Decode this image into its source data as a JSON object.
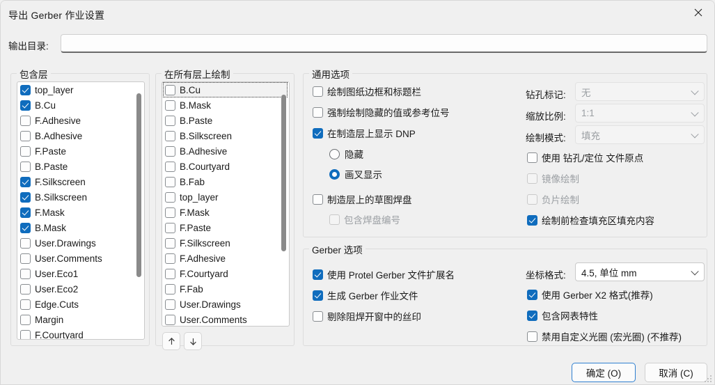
{
  "window": {
    "title": "导出 Gerber 作业设置",
    "close_icon": "close-icon"
  },
  "output_dir": {
    "label": "输出目录:",
    "value": "",
    "placeholder": ""
  },
  "include_layers": {
    "title": "包含层",
    "items": [
      {
        "label": "top_layer",
        "checked": true
      },
      {
        "label": "B.Cu",
        "checked": true
      },
      {
        "label": "F.Adhesive",
        "checked": false
      },
      {
        "label": "B.Adhesive",
        "checked": false
      },
      {
        "label": "F.Paste",
        "checked": false
      },
      {
        "label": "B.Paste",
        "checked": false
      },
      {
        "label": "F.Silkscreen",
        "checked": true
      },
      {
        "label": "B.Silkscreen",
        "checked": true
      },
      {
        "label": "F.Mask",
        "checked": true
      },
      {
        "label": "B.Mask",
        "checked": true
      },
      {
        "label": "User.Drawings",
        "checked": false
      },
      {
        "label": "User.Comments",
        "checked": false
      },
      {
        "label": "User.Eco1",
        "checked": false
      },
      {
        "label": "User.Eco2",
        "checked": false
      },
      {
        "label": "Edge.Cuts",
        "checked": false
      },
      {
        "label": "Margin",
        "checked": false
      },
      {
        "label": "F.Courtyard",
        "checked": false
      }
    ]
  },
  "plot_on_all_layers": {
    "title": "在所有层上绘制",
    "items": [
      {
        "label": "B.Cu",
        "checked": false,
        "focused": true
      },
      {
        "label": "B.Mask",
        "checked": false,
        "focused": false
      },
      {
        "label": "B.Paste",
        "checked": false,
        "focused": false
      },
      {
        "label": "B.Silkscreen",
        "checked": false,
        "focused": false
      },
      {
        "label": "B.Adhesive",
        "checked": false,
        "focused": false
      },
      {
        "label": "B.Courtyard",
        "checked": false,
        "focused": false
      },
      {
        "label": "B.Fab",
        "checked": false,
        "focused": false
      },
      {
        "label": "top_layer",
        "checked": false,
        "focused": false
      },
      {
        "label": "F.Mask",
        "checked": false,
        "focused": false
      },
      {
        "label": "F.Paste",
        "checked": false,
        "focused": false
      },
      {
        "label": "F.Silkscreen",
        "checked": false,
        "focused": false
      },
      {
        "label": "F.Adhesive",
        "checked": false,
        "focused": false
      },
      {
        "label": "F.Courtyard",
        "checked": false,
        "focused": false
      },
      {
        "label": "F.Fab",
        "checked": false,
        "focused": false
      },
      {
        "label": "User.Drawings",
        "checked": false,
        "focused": false
      },
      {
        "label": "User.Comments",
        "checked": false,
        "focused": false
      }
    ],
    "move_up_icon": "arrow-up-icon",
    "move_down_icon": "arrow-down-icon"
  },
  "general_options": {
    "title": "通用选项",
    "checkboxes": [
      {
        "label": "绘制图纸边框和标题栏",
        "checked": false,
        "disabled": false
      },
      {
        "label": "强制绘制隐藏的值或参考位号",
        "checked": false,
        "disabled": false
      },
      {
        "label": "在制造层上显示 DNP",
        "checked": true,
        "disabled": false
      },
      {
        "label": "制造层上的草图焊盘",
        "checked": false,
        "disabled": false
      },
      {
        "label": "包含焊盘编号",
        "checked": false,
        "disabled": true
      }
    ],
    "dnp_radios": [
      {
        "label": "隐藏",
        "selected": false
      },
      {
        "label": "画叉显示",
        "selected": true
      }
    ],
    "fields": [
      {
        "label": "钻孔标记:",
        "value": "无",
        "disabled": true
      },
      {
        "label": "缩放比例:",
        "value": "1:1",
        "disabled": true
      },
      {
        "label": "绘制模式:",
        "value": "填充",
        "disabled": true
      }
    ],
    "right_checkboxes": [
      {
        "label": "使用 钻孔/定位 文件原点",
        "checked": false,
        "disabled": false
      },
      {
        "label": "镜像绘制",
        "checked": false,
        "disabled": true
      },
      {
        "label": "负片绘制",
        "checked": false,
        "disabled": true
      },
      {
        "label": "绘制前检查填充区填充内容",
        "checked": true,
        "disabled": false
      }
    ]
  },
  "gerber_options": {
    "title": "Gerber 选项",
    "left_checkboxes": [
      {
        "label": "使用 Protel Gerber 文件扩展名",
        "checked": true
      },
      {
        "label": "生成 Gerber 作业文件",
        "checked": true
      },
      {
        "label": "剔除阻焊开窗中的丝印",
        "checked": false
      }
    ],
    "coord_field": {
      "label": "坐标格式:",
      "value": "4.5, 单位 mm",
      "disabled": false
    },
    "right_checkboxes": [
      {
        "label": "使用 Gerber X2 格式(推荐)",
        "checked": true
      },
      {
        "label": "包含网表特性",
        "checked": true
      },
      {
        "label": "禁用自定义光圈 (宏光圈) (不推荐)",
        "checked": false
      }
    ]
  },
  "footer": {
    "ok_label": "确定 (O)",
    "cancel_label": "取消 (C)"
  },
  "colors": {
    "accent": "#0f6cbd",
    "window_bg": "#f0f0f0",
    "list_bg": "#ffffff",
    "focus_border": "#2f7fd0"
  }
}
